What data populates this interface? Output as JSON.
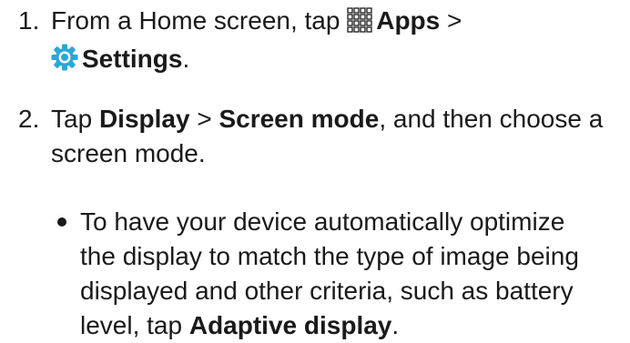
{
  "steps": [
    {
      "number": "1.",
      "line1_prefix": "From a Home screen, tap ",
      "apps_icon": "apps-grid-icon",
      "apps_label": "Apps",
      "separator": " >",
      "settings_icon": "settings-gear-icon",
      "settings_label": "Settings",
      "period": "."
    },
    {
      "number": "2.",
      "prefix": "Tap ",
      "display_label": "Display",
      "separator": " > ",
      "screen_mode_label": "Screen mode",
      "line1_suffix": ", and then choose a",
      "line2": "screen mode."
    }
  ],
  "bullet": {
    "line1": "To have your device automatically optimize",
    "line2": "the display to match the type of image being",
    "line3": "displayed and other criteria, such as battery",
    "line4_prefix": "level, tap ",
    "adaptive_label": "Adaptive display",
    "line4_suffix": "."
  },
  "colors": {
    "text": "#1a1a1a",
    "settings_icon_blue": "#2aa7d8"
  }
}
